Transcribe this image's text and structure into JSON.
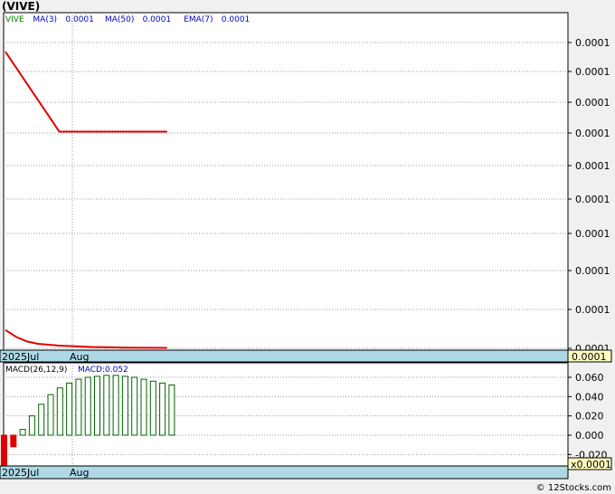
{
  "title": "(VIVE)",
  "credit": "© 12Stocks.com",
  "colors": {
    "price_line": "#e00000",
    "grid": "#999999",
    "axis_band": "#add8e6",
    "macd_bar": "#006400",
    "macd_neg": "#e00000",
    "legend_ticker": "#008000",
    "legend_ma": "#0000c0"
  },
  "chart_data": [
    {
      "type": "line",
      "panel": "price",
      "legend": [
        {
          "label": "VIVE",
          "color": "#008000"
        },
        {
          "label": "MA(3)",
          "color": "#0000c0"
        },
        {
          "label": "0.0001",
          "color": "#0000c0"
        },
        {
          "label": "MA(50)",
          "color": "#0000c0"
        },
        {
          "label": "0.0001",
          "color": "#0000c0"
        },
        {
          "label": "EMA(7)",
          "color": "#0000c0"
        },
        {
          "label": "0.0001",
          "color": "#0000c0"
        }
      ],
      "y_tick_labels": [
        "0.0001",
        "0.0001",
        "0.0001",
        "0.0001",
        "0.0001",
        "0.0001",
        "0.0001",
        "0.0001",
        "0.0001",
        "0.0001"
      ],
      "last_value_label": "0.0001",
      "x_tick_labels": [
        "2025Jul",
        "Aug"
      ],
      "series": [
        {
          "name": "VIVE",
          "x": [
            0,
            10,
            30
          ],
          "y": [
            0.00014,
            0.000105,
            0.000105
          ]
        },
        {
          "x": [
            0,
            2,
            4,
            6,
            10,
            16,
            22,
            30
          ],
          "y": [
            1.8e-05,
            1.5e-05,
            1.3e-05,
            1.2e-05,
            1.12e-05,
            1.06e-05,
            1.03e-05,
            1.02e-05
          ]
        }
      ],
      "ylim": [
        1e-05,
        0.00015
      ],
      "xlim": [
        0,
        104
      ]
    },
    {
      "type": "bar",
      "panel": "macd",
      "legend": [
        {
          "label": "MACD(26,12,9)",
          "color": "#000000"
        },
        {
          "label": "MACD:0.052",
          "color": "#0000c0"
        }
      ],
      "y_tick_labels": [
        "0.060",
        "0.040",
        "0.020",
        "0.000",
        "-0.020"
      ],
      "y_tick_values": [
        0.06,
        0.04,
        0.02,
        0.0,
        -0.02
      ],
      "last_value_label": "x0.0001",
      "x_tick_labels": [
        "2025Jul",
        "Aug"
      ],
      "values": [
        -0.034,
        -0.012,
        0.006,
        0.02,
        0.032,
        0.042,
        0.049,
        0.054,
        0.058,
        0.06,
        0.061,
        0.062,
        0.062,
        0.061,
        0.06,
        0.058,
        0.056,
        0.054,
        0.052
      ],
      "ylim": [
        -0.034,
        0.065
      ]
    }
  ]
}
